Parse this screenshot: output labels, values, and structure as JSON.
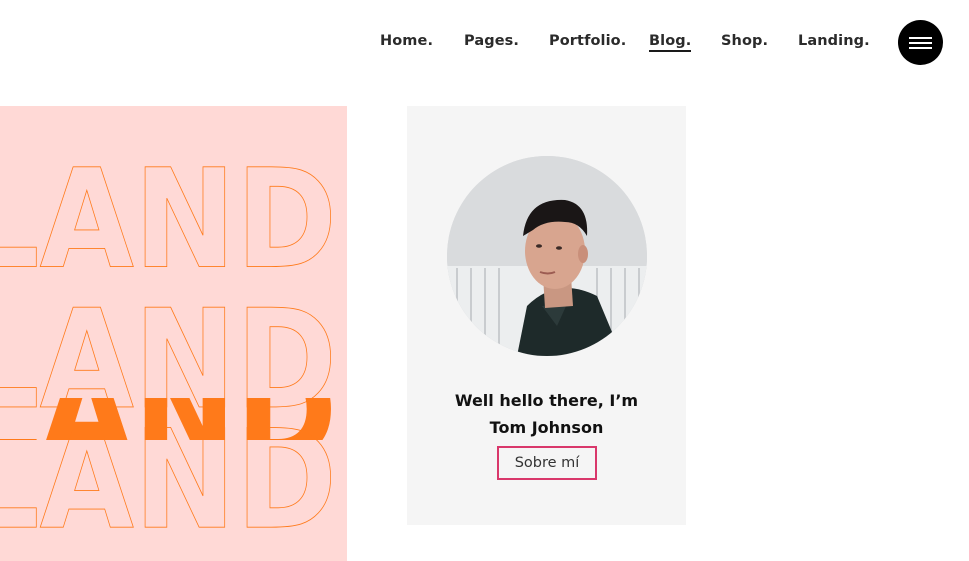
{
  "nav": {
    "items": [
      {
        "label": "Home.",
        "active": false
      },
      {
        "label": "Pages.",
        "active": false
      },
      {
        "label": "Portfolio.",
        "active": false
      },
      {
        "label": "Blog.",
        "active": true
      },
      {
        "label": "Shop.",
        "active": false
      },
      {
        "label": "Landing.",
        "active": false
      }
    ],
    "menu_icon": "hamburger-icon"
  },
  "art": {
    "word": "LAND",
    "background_color": "#ffd9d6",
    "stroke_color": "#ff7a1a"
  },
  "profile": {
    "greeting_line1": "Well hello there, I’m",
    "greeting_line2": "Tom Johnson",
    "button_label": "Sobre mí",
    "button_border_color": "#d9376b"
  }
}
